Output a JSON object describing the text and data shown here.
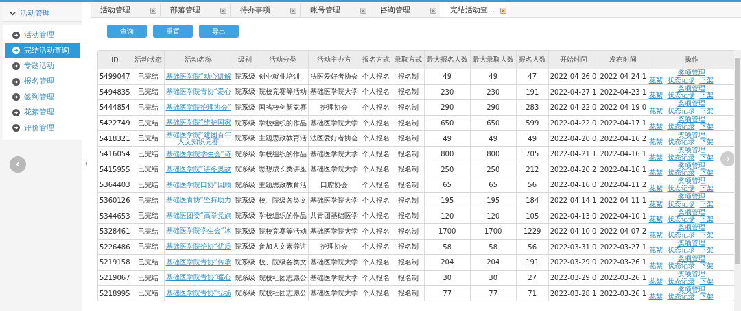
{
  "sidebar": {
    "title": "活动管理",
    "items": [
      {
        "label": "活动管理",
        "selected": false
      },
      {
        "label": "完结活动查询",
        "selected": true
      },
      {
        "label": "专题活动",
        "selected": false
      },
      {
        "label": "报名管理",
        "selected": false
      },
      {
        "label": "签到管理",
        "selected": false
      },
      {
        "label": "花絮管理",
        "selected": false
      },
      {
        "label": "评价管理",
        "selected": false
      }
    ]
  },
  "tabs": [
    {
      "label": "活动管理",
      "selected": false
    },
    {
      "label": "部落管理",
      "selected": false
    },
    {
      "label": "待办事项",
      "selected": false
    },
    {
      "label": "账号管理",
      "selected": false
    },
    {
      "label": "咨询管理",
      "selected": false
    },
    {
      "label": "完结活动查...",
      "selected": true
    }
  ],
  "buttons": [
    "查询",
    "重置",
    "导出"
  ],
  "table": {
    "columns": [
      "ID",
      "活动状态",
      "活动名称",
      "级别",
      "活动分类",
      "活动主办方",
      "报名方式",
      "录取方式",
      "最大报名人数",
      "最大录取人数",
      "报名人数",
      "开始时间",
      "发布时间",
      "操作"
    ],
    "rows": [
      {
        "id": "5499047",
        "status": "已完结",
        "name_lines": [
          "基础医学院“动心讲解"
        ],
        "level": "院系级",
        "category": "创业就业培训、",
        "organizer": "法医爱好者协会",
        "signup_mode": "个人报名",
        "admit_mode": "报名制",
        "max_signup": "49",
        "max_admit": "49",
        "signups": "47",
        "start_time": "2022-04-26 0",
        "publish_time": "2022-04-24 1",
        "actions": [
          "奖项管理",
          "花絮",
          "状态记录",
          "下架"
        ]
      },
      {
        "id": "5494835",
        "status": "已完结",
        "name_lines": [
          "基础医学院青协“爱心"
        ],
        "level": "院系级",
        "category": "院校竞赛等活动",
        "organizer": "基础医学院大学",
        "signup_mode": "个人报名",
        "admit_mode": "报名制",
        "max_signup": "230",
        "max_admit": "230",
        "signups": "191",
        "start_time": "2022-04-27 1",
        "publish_time": "2022-04-23 1",
        "actions": [
          "奖项管理",
          "花絮",
          "状态记录",
          "下架"
        ]
      },
      {
        "id": "5444854",
        "status": "已完结",
        "name_lines": [
          "基础医学院护理协会“"
        ],
        "level": "院系级",
        "category": "国省校创新竞赛",
        "organizer": "护理协会",
        "signup_mode": "个人报名",
        "admit_mode": "报名制",
        "max_signup": "290",
        "max_admit": "290",
        "signups": "283",
        "start_time": "2022-04-22 0",
        "publish_time": "2022-04-19 0",
        "actions": [
          "奖项管理",
          "花絮",
          "状态记录",
          "下架"
        ]
      },
      {
        "id": "5422749",
        "status": "已完结",
        "name_lines": [
          "基础医学院“维护国家"
        ],
        "level": "院系级",
        "category": "学校组织的作品",
        "organizer": "基础医学院大学",
        "signup_mode": "个人报名",
        "admit_mode": "报名制",
        "max_signup": "650",
        "max_admit": "650",
        "signups": "599",
        "start_time": "2022-04-22 0",
        "publish_time": "2022-04-17 1",
        "actions": [
          "奖项管理",
          "花絮",
          "状态记录",
          "下架"
        ]
      },
      {
        "id": "5418321",
        "status": "已完结",
        "name_lines": [
          "基础医学院“建团百年",
          "人文知识竞赛"
        ],
        "level": "院系级",
        "category": "主题思政教育活",
        "organizer": "法医爱好者协会",
        "signup_mode": "个人报名",
        "admit_mode": "报名制",
        "max_signup": "49",
        "max_admit": "49",
        "signups": "49",
        "start_time": "2022-04-20 0",
        "publish_time": "2022-04-16 2",
        "actions": [
          "奖项管理",
          "花絮",
          "状态记录",
          "下架"
        ]
      },
      {
        "id": "5416054",
        "status": "已完结",
        "name_lines": [
          "基础医学院学生会“诗"
        ],
        "level": "院系级",
        "category": "学校组织的作品",
        "organizer": "基础医学院大学",
        "signup_mode": "个人报名",
        "admit_mode": "报名制",
        "max_signup": "800",
        "max_admit": "800",
        "signups": "705",
        "start_time": "2022-04-21 1",
        "publish_time": "2022-04-16 1",
        "actions": [
          "奖项管理",
          "花絮",
          "状态记录",
          "下架"
        ]
      },
      {
        "id": "5415955",
        "status": "已完结",
        "name_lines": [
          "基础医学院“讲冬奥故"
        ],
        "level": "院系级",
        "category": "思想成长类讲座",
        "organizer": "基础医学院大学",
        "signup_mode": "个人报名",
        "admit_mode": "报名制",
        "max_signup": "250",
        "max_admit": "250",
        "signups": "212",
        "start_time": "2022-04-20 2",
        "publish_time": "2022-04-16 1",
        "actions": [
          "奖项管理",
          "花絮",
          "状态记录",
          "下架"
        ]
      },
      {
        "id": "5364403",
        "status": "已完结",
        "name_lines": [
          "基础医学院口协“回顾"
        ],
        "level": "院系级",
        "category": "主题思政教育活",
        "organizer": "口腔协会",
        "signup_mode": "个人报名",
        "admit_mode": "报名制",
        "max_signup": "65",
        "max_admit": "65",
        "signups": "56",
        "start_time": "2022-04-16 0",
        "publish_time": "2022-04-11 2",
        "actions": [
          "奖项管理",
          "花絮",
          "状态记录",
          "下架"
        ]
      },
      {
        "id": "5360126",
        "status": "已完结",
        "name_lines": [
          "基础医青协“坚持助力"
        ],
        "level": "院系级",
        "category": "校、院级各类文",
        "organizer": "基础医学院大学",
        "signup_mode": "个人报名",
        "admit_mode": "报名制",
        "max_signup": "195",
        "max_admit": "195",
        "signups": "184",
        "start_time": "2022-04-14 1",
        "publish_time": "2022-04-11 1",
        "actions": [
          "奖项管理",
          "花絮",
          "状态记录",
          "下架"
        ]
      },
      {
        "id": "5344653",
        "status": "已完结",
        "name_lines": [
          "基础医团委“高举党旗"
        ],
        "level": "院系级",
        "category": "学校组织的作品",
        "organizer": "共青团基础医学",
        "signup_mode": "个人报名",
        "admit_mode": "报名制",
        "max_signup": "120",
        "max_admit": "120",
        "signups": "105",
        "start_time": "2022-04-13 0",
        "publish_time": "2022-04-10 1",
        "actions": [
          "奖项管理",
          "花絮",
          "状态记录",
          "下架"
        ]
      },
      {
        "id": "5328461",
        "status": "已完结",
        "name_lines": [
          "基础医学院学生会“冰"
        ],
        "level": "院系级",
        "category": "院校竞赛等活动",
        "organizer": "基础医学院大学",
        "signup_mode": "个人报名",
        "admit_mode": "报名制",
        "max_signup": "1700",
        "max_admit": "1700",
        "signups": "1229",
        "start_time": "2022-04-10 0",
        "publish_time": "2022-04-07 2",
        "actions": [
          "奖项管理",
          "花絮",
          "状态记录",
          "下架"
        ]
      },
      {
        "id": "5226486",
        "status": "已完结",
        "name_lines": [
          "基础医学院护协“优质"
        ],
        "level": "院系级",
        "category": "参加人文素养讲",
        "organizer": "护理协会",
        "signup_mode": "个人报名",
        "admit_mode": "报名制",
        "max_signup": "58",
        "max_admit": "58",
        "signups": "56",
        "start_time": "2022-03-31 0",
        "publish_time": "2022-03-27 1",
        "actions": [
          "奖项管理",
          "花絮",
          "状态记录",
          "下架"
        ]
      },
      {
        "id": "5219158",
        "status": "已完结",
        "name_lines": [
          "基础医学院青协“传承"
        ],
        "level": "院系级",
        "category": "校、院级各类文",
        "organizer": "基础医学院大学",
        "signup_mode": "个人报名",
        "admit_mode": "报名制",
        "max_signup": "204",
        "max_admit": "204",
        "signups": "191",
        "start_time": "2022-03-29 0",
        "publish_time": "2022-03-26 1",
        "actions": [
          "奖项管理",
          "花絮",
          "状态记录",
          "下架"
        ]
      },
      {
        "id": "5219067",
        "status": "已完结",
        "name_lines": [
          "基础医学院青协“暖心"
        ],
        "level": "院系级",
        "category": "院校社团志愿公",
        "organizer": "基础医学院大学",
        "signup_mode": "个人报名",
        "admit_mode": "报名制",
        "max_signup": "30",
        "max_admit": "30",
        "signups": "27",
        "start_time": "2022-03-29 0",
        "publish_time": "2022-03-26 1",
        "actions": [
          "奖项管理",
          "花絮",
          "状态记录",
          "下架"
        ]
      },
      {
        "id": "5218995",
        "status": "已完结",
        "name_lines": [
          "基础医学院青协“弘扬"
        ],
        "level": "院系级",
        "category": "院校社团志愿公",
        "organizer": "基础医学院大学",
        "signup_mode": "个人报名",
        "admit_mode": "报名制",
        "max_signup": "77",
        "max_admit": "77",
        "signups": "71",
        "start_time": "2022-03-28 1",
        "publish_time": "2022-03-26 1",
        "actions": [
          "奖项管理",
          "花絮",
          "状态记录",
          "下架"
        ]
      }
    ]
  }
}
